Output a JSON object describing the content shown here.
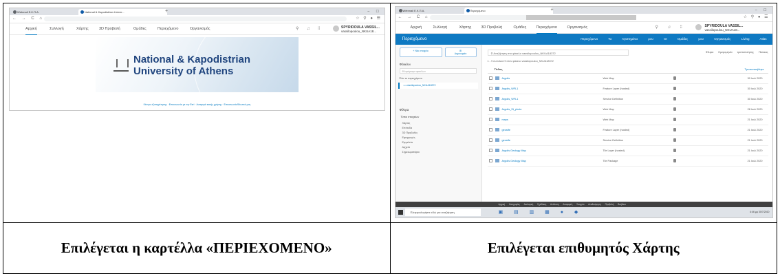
{
  "captions": {
    "left": "Επιλέγεται η καρτέλλα «ΠΕΡΙΕΧΟΜΕΝΟ»",
    "right": "Επιλέγεται επιθυμητός Χάρτης"
  },
  "left_shot": {
    "tabs": [
      "Webmail Ε.Κ.Π.Α.",
      "National & Kapodistrian Univer..."
    ],
    "nav": [
      "Αρχική",
      "Συλλογή",
      "Χάρτης",
      "3D Προβολή",
      "Ομάδες",
      "Περιεχόμενο",
      "Οργανισμός"
    ],
    "user_name": "SPYRIDOULA VASSIL...",
    "user_sub": "vassilopoulou_NKUA18...",
    "banner_line1": "National & Kapodistrian",
    "banner_line2": "University of Athens",
    "footer": "Κέντρο εξυπηρέτησης · Επικοινωνία με την Esri · Αναφορά κακής χρήσης · Επικοινωνία/Ιδιωτικό μας"
  },
  "right_shot": {
    "tabs": [
      "Webmail Ε.Κ.Π.Α.",
      "Περιεχόμενο"
    ],
    "nav": [
      "Αρχική",
      "Συλλογή",
      "Χάρτης",
      "3D Προβολή",
      "Ομάδες",
      "Περιεχόμενο",
      "Οργανισμός"
    ],
    "user_name": "SPYRIDOULA VASSIL...",
    "user_sub": "vassilopoulou_NKUA18...",
    "bar_title": "Περιεχόμενο",
    "bar_tabs": [
      "Περιεχόμενο",
      "Τα Αγαπημένα μου",
      "Οι Ομάδες μου",
      "Οργανισμός",
      "Living Atlas"
    ],
    "new_item": "Νέο στοιχείο",
    "create": "Δημιουργία",
    "search_placeholder": "Αναζήτηση στο φάκελο vassilopoulou_NKUA18372",
    "tools": [
      "Φίλτρα",
      "Ημερομηνία τροποποίησης",
      "Πίνακας"
    ],
    "item_count": "1 - 9 συνολικά 9 στον φάκελο vassilopoulou_NKUA18372",
    "folders_label": "Φάκελοι",
    "folder_filter": "Φιλτράρισμα φακέλων",
    "all_content": "Όλο το περιεχόμενο",
    "user_folder": "vassilopoulou_NKUA18372",
    "filters_label": "Φίλτρα",
    "item_types_label": "Τύποι στοιχείων",
    "filter_items": [
      "Χάρτες",
      "Επίπεδα",
      "3D Προβολές",
      "Εφαρμογές",
      "Εργαλεία",
      "Αρχεία",
      "Σημειωματάριο"
    ],
    "col_title": "Τίτλος",
    "col_modified": "Τροποποιήθηκε",
    "rows": [
      {
        "name": "Argolis",
        "type": "Web Map",
        "date": "30 Ιουλ 2020"
      },
      {
        "name": "Argolis_WFL1",
        "type": "Feature Layer (hosted)",
        "date": "30 Ιουλ 2020"
      },
      {
        "name": "Argolis_WFL1",
        "type": "Service Definition",
        "date": "30 Ιουλ 2020"
      },
      {
        "name": "Argolis_St_photo",
        "type": "Web Map",
        "date": "28 Ιουλ 2020"
      },
      {
        "name": "maps",
        "type": "Web Map",
        "date": "21 Ιουλ 2020"
      },
      {
        "name": "geostfe",
        "type": "Feature Layer (hosted)",
        "date": "21 Ιουλ 2020"
      },
      {
        "name": "geostfe",
        "type": "Service Definition",
        "date": "21 Ιουλ 2020"
      },
      {
        "name": "Argolis Geology Map",
        "type": "Tile Layer (hosted)",
        "date": "21 Ιουλ 2020"
      },
      {
        "name": "Argolis Geology Map",
        "type": "Tile Package",
        "date": "21 Ιουλ 2020"
      }
    ],
    "status_items": [
      "Αρχική",
      "Κατηγορίες",
      "Διαλογική",
      "Σχεδίαση",
      "Ανάλυση",
      "Αναφορές",
      "Στοιχεία",
      "Αναθεώρηση",
      "Προβολή",
      "Βοήθεια"
    ],
    "taskbar_search": "Πληκτρολογήστε εδώ για αναζήτηση",
    "tray_time": "4:46 μμ",
    "tray_date": "30/7/2020"
  }
}
